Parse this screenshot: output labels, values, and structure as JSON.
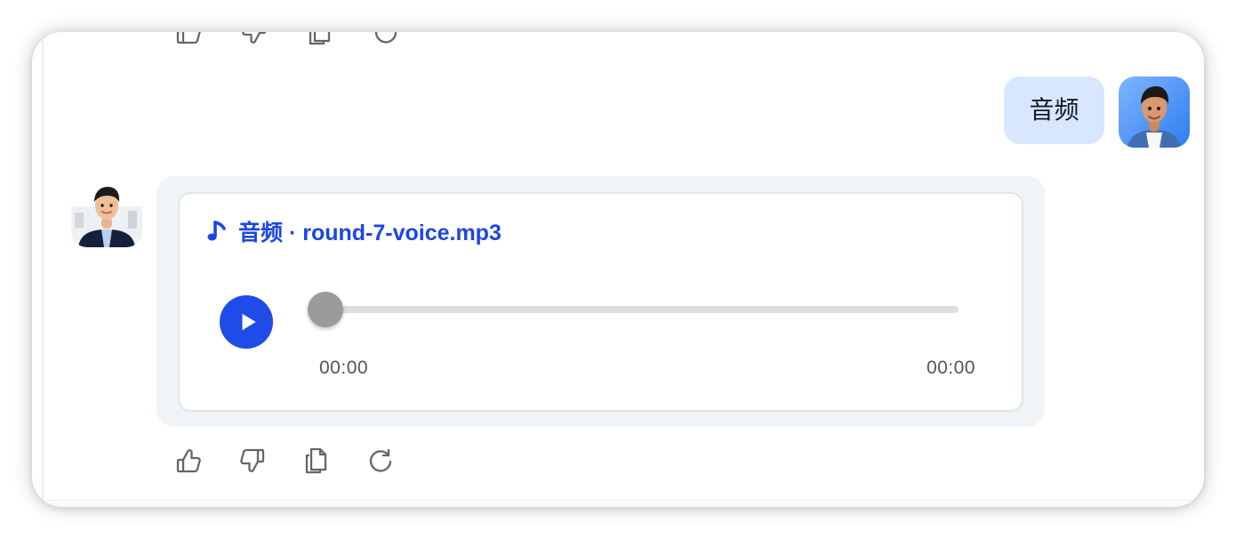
{
  "chat": {
    "user_message": "音频",
    "audio": {
      "title": "音频 · round-7-voice.mp3",
      "current_time": "00:00",
      "duration": "00:00",
      "progress": 0,
      "accent_color": "#1f4be8"
    },
    "actions": [
      {
        "name": "thumbs-up-icon"
      },
      {
        "name": "thumbs-down-icon"
      },
      {
        "name": "copy-icon"
      },
      {
        "name": "refresh-icon"
      }
    ]
  }
}
